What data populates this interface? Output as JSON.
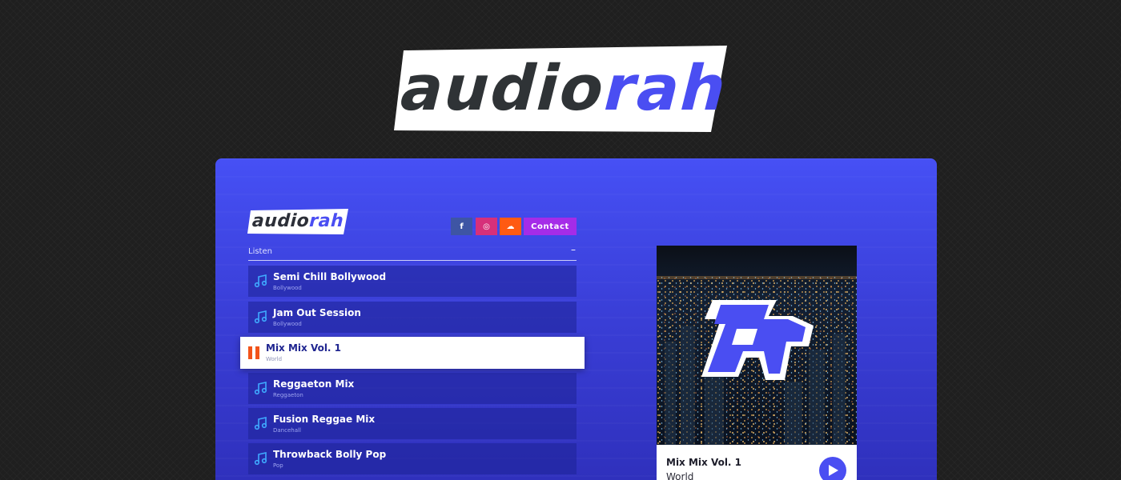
{
  "brand": {
    "logo_part1": "audio",
    "logo_part2": "rah",
    "colors": {
      "dark": "#2f3336",
      "accent": "#4a4ef2",
      "outline": "#ffffff"
    }
  },
  "panel": {
    "mini_logo_part1": "audio",
    "mini_logo_part2": "rah",
    "social": [
      {
        "name": "facebook-icon",
        "glyph": "f",
        "color": "#3e55a4"
      },
      {
        "name": "instagram-icon",
        "glyph": "◎",
        "color": "#d6307a"
      },
      {
        "name": "soundcloud-icon",
        "glyph": "☁",
        "color": "#ff5a12"
      }
    ],
    "contact_label": "Contact",
    "listen_label": "Listen",
    "collapse_glyph": "–"
  },
  "tracks": [
    {
      "title": "Semi Chill Bollywood",
      "genre": "Bollywood",
      "active": false
    },
    {
      "title": "Jam Out Session",
      "genre": "Bollywood",
      "active": false
    },
    {
      "title": "Mix Mix Vol. 1",
      "genre": "World",
      "active": true
    },
    {
      "title": "Reggaeton Mix",
      "genre": "Reggaeton",
      "active": false
    },
    {
      "title": "Fusion Reggae Mix",
      "genre": "Dancehall",
      "active": false
    },
    {
      "title": "Throwback Bolly Pop",
      "genre": "Pop",
      "active": false
    }
  ],
  "now_playing": {
    "title": "Mix Mix Vol. 1",
    "genre": "World",
    "art_label": "ar"
  }
}
